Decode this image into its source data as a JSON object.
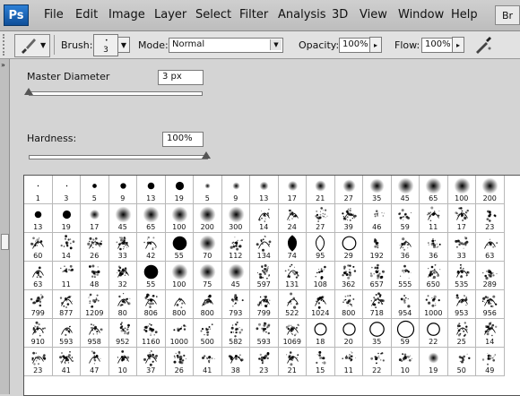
{
  "menubar": {
    "logo": "Ps",
    "items": [
      "File",
      "Edit",
      "Image",
      "Layer",
      "Select",
      "Filter",
      "Analysis",
      "3D",
      "View",
      "Window",
      "Help"
    ],
    "right_button": "Br"
  },
  "options": {
    "brush_label": "Brush:",
    "brush_size": "3",
    "mode_label": "Mode:",
    "mode_value": "Normal",
    "opacity_label": "Opacity:",
    "opacity_value": "100%",
    "flow_label": "Flow:",
    "flow_value": "100%"
  },
  "brush_panel": {
    "master_diameter_label": "Master Diameter",
    "master_diameter_value": "3 px",
    "master_diameter_fraction": 0.0,
    "hardness_label": "Hardness:",
    "hardness_value": "100%",
    "hardness_fraction": 1.0
  },
  "brush_rows": [
    [
      "1",
      "3",
      "5",
      "9",
      "13",
      "19",
      "5",
      "9",
      "13",
      "17",
      "21",
      "27",
      "35",
      "45",
      "65",
      "100",
      "200"
    ],
    [
      "13",
      "19",
      "17",
      "45",
      "65",
      "100",
      "200",
      "300",
      "14",
      "24",
      "27",
      "39",
      "46",
      "59",
      "11",
      "17",
      "23"
    ],
    [
      "60",
      "14",
      "26",
      "33",
      "42",
      "55",
      "70",
      "112",
      "134",
      "74",
      "95",
      "29",
      "192",
      "36",
      "36",
      "33",
      "63"
    ],
    [
      "63",
      "11",
      "48",
      "32",
      "55",
      "100",
      "75",
      "45",
      "597",
      "131",
      "108",
      "362",
      "657",
      "555",
      "650",
      "535",
      "289"
    ],
    [
      "799",
      "877",
      "1209",
      "80",
      "806",
      "800",
      "800",
      "793",
      "799",
      "522",
      "1024",
      "800",
      "718",
      "954",
      "1000",
      "953",
      "956"
    ],
    [
      "910",
      "593",
      "958",
      "952",
      "1160",
      "1000",
      "500",
      "582",
      "593",
      "1069",
      "18",
      "20",
      "35",
      "59",
      "22",
      "25",
      "14"
    ],
    [
      "23",
      "41",
      "47",
      "10",
      "37",
      "26",
      "41",
      "38",
      "23",
      "21",
      "15",
      "11",
      "22",
      "10",
      "19",
      "50",
      "49"
    ]
  ],
  "brush_types": [
    [
      "h",
      "h",
      "h",
      "h",
      "h",
      "h",
      "s",
      "s",
      "s",
      "s",
      "s",
      "s",
      "s",
      "s",
      "s",
      "s",
      "s"
    ],
    [
      "h",
      "h",
      "s",
      "s",
      "s",
      "s",
      "s",
      "s",
      "t",
      "t",
      "t",
      "t",
      "t",
      "t",
      "t",
      "t",
      "t"
    ],
    [
      "t",
      "t",
      "t",
      "t",
      "t",
      "h",
      "s",
      "t",
      "t",
      "l",
      "l",
      "o",
      "t",
      "t",
      "t",
      "t",
      "t"
    ],
    [
      "t",
      "t",
      "t",
      "t",
      "h",
      "s",
      "s",
      "s",
      "t",
      "t",
      "t",
      "t",
      "t",
      "t",
      "t",
      "t",
      "t"
    ],
    [
      "t",
      "t",
      "t",
      "t",
      "t",
      "t",
      "t",
      "t",
      "t",
      "t",
      "t",
      "t",
      "t",
      "t",
      "t",
      "t",
      "t"
    ],
    [
      "t",
      "t",
      "t",
      "t",
      "t",
      "t",
      "t",
      "t",
      "t",
      "t",
      "o",
      "o",
      "o",
      "o",
      "o",
      "t",
      "t"
    ],
    [
      "t",
      "t",
      "t",
      "t",
      "t",
      "t",
      "t",
      "t",
      "t",
      "t",
      "t",
      "t",
      "t",
      "t",
      "s",
      "t",
      "t"
    ]
  ],
  "icons": {
    "brush_tool": "brush-icon",
    "airbrush": "airbrush-icon"
  }
}
